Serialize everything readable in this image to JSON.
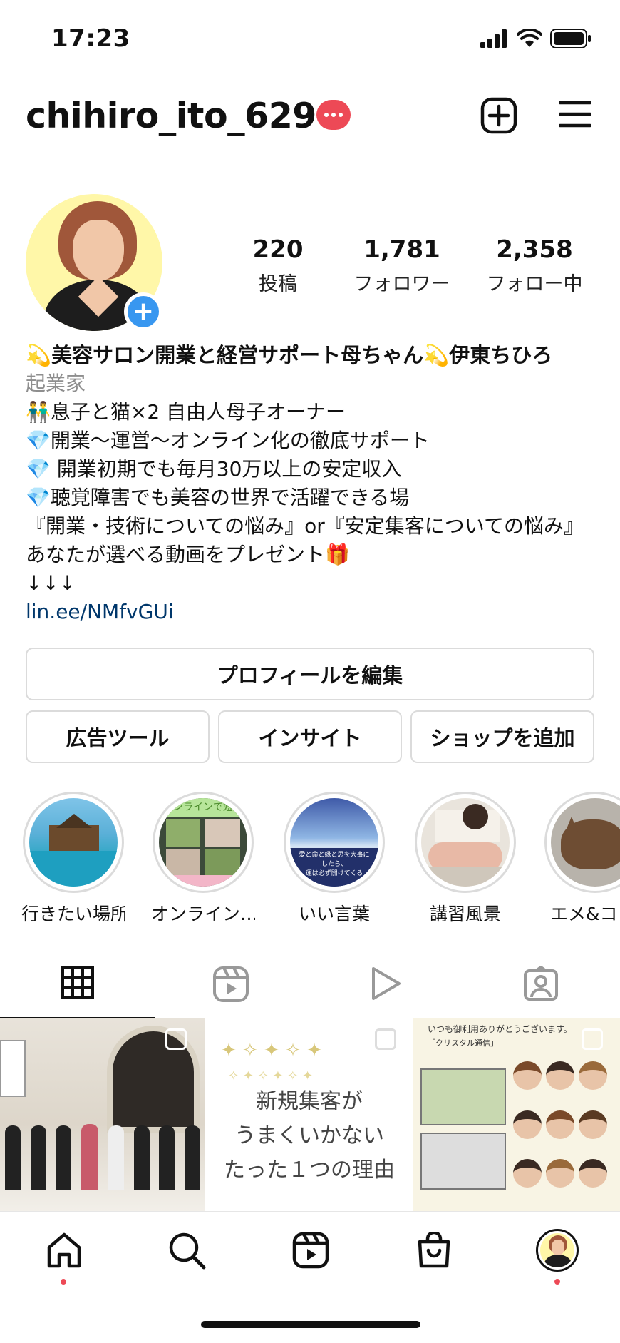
{
  "status_bar": {
    "time": "17:23",
    "icons": [
      "signal-icon",
      "wifi-icon",
      "battery-icon"
    ]
  },
  "header": {
    "username": "chihiro_ito_629",
    "icons": [
      "notification-badge-icon",
      "new-post-icon",
      "menu-icon"
    ]
  },
  "profile": {
    "stats": [
      {
        "value": "220",
        "label": "投稿"
      },
      {
        "value": "1,781",
        "label": "フォロワー"
      },
      {
        "value": "2,358",
        "label": "フォロー中"
      }
    ],
    "bio": {
      "name": "💫美容サロン開業と経営サポート母ちゃん💫伊東ちひろ",
      "category": "起業家",
      "lines": [
        "👬息子と猫×2 自由人母子オーナー",
        "💎開業〜運営〜オンライン化の徹底サポート",
        "💎 開業初期でも毎月30万以上の安定収入",
        "💎聴覚障害でも美容の世界で活躍できる場",
        "『開業・技術についての悩み』or『安定集客についての悩み』あなたが選べる動画をプレゼント🎁",
        "↓↓↓"
      ],
      "link": "lin.ee/NMfvGUi"
    }
  },
  "buttons": {
    "edit_profile": "プロフィールを編集",
    "ad_tools": "広告ツール",
    "insights": "インサイト",
    "add_shop": "ショップを追加"
  },
  "highlights": [
    {
      "label": "行きたい場所"
    },
    {
      "label": "オンライン…"
    },
    {
      "label": "いい言葉"
    },
    {
      "label": "講習風景"
    },
    {
      "label": "エメ&コ"
    }
  ],
  "highlight_texts": {
    "online": "オンラインで勉強",
    "quote_line1": "愛と命と縁と思を大事に",
    "quote_line2": "したら、",
    "quote_line3": "運は必ず開けてくる"
  },
  "tabs": [
    "grid-icon",
    "reels-icon",
    "video-icon",
    "tagged-icon"
  ],
  "posts": {
    "post2_lines": [
      "新規集客が",
      "うまくいかない",
      "たった１つの理由"
    ],
    "post3_header": "いつも御利用ありがとうございます。",
    "post3_sub": "「クリスタル通信」"
  },
  "bottom_nav": [
    "home-icon",
    "search-icon",
    "reels-icon",
    "shop-icon",
    "profile-avatar"
  ],
  "colors": {
    "accent_red": "#ed4956",
    "link_blue": "#00376b",
    "badge_blue": "#3897f0",
    "border": "#dbdbdb"
  }
}
